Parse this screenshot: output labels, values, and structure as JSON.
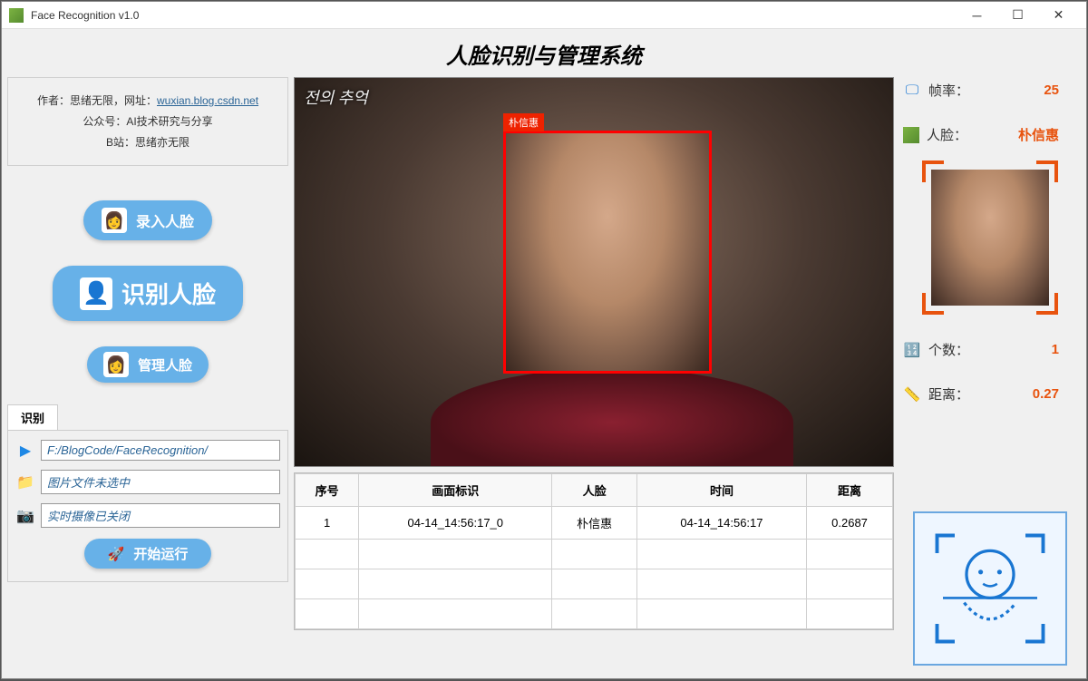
{
  "window": {
    "title": "Face Recognition v1.0"
  },
  "app_title": "人脸识别与管理系统",
  "info": {
    "author_label": "作者：",
    "author": "思绪无限",
    "url_label": "，网址：",
    "url": "wuxian.blog.csdn.net",
    "wechat_label": "公众号：",
    "wechat": "AI技术研究与分享",
    "bilibili_label": "B站：",
    "bilibili": "思绪亦无限"
  },
  "buttons": {
    "enroll": "录入人脸",
    "recognize": "识别人脸",
    "manage": "管理人脸",
    "run": "开始运行"
  },
  "tab": {
    "label": "识别",
    "video_path": "F:/BlogCode/FaceRecognition/",
    "image_status": "图片文件未选中",
    "camera_status": "实时摄像已关闭"
  },
  "video": {
    "overlay_text": "전의 추억",
    "detected_name": "朴信惠"
  },
  "stats": {
    "fps_label": "帧率：",
    "fps_value": "25",
    "face_label": "人脸：",
    "face_value": "朴信惠",
    "count_label": "个数：",
    "count_value": "1",
    "distance_label": "距离：",
    "distance_value": "0.27"
  },
  "table": {
    "headers": {
      "seq": "序号",
      "frame_id": "画面标识",
      "face": "人脸",
      "time": "时间",
      "distance": "距离"
    },
    "rows": [
      {
        "seq": "1",
        "frame_id": "04-14_14:56:17_0",
        "face": "朴信惠",
        "time": "04-14_14:56:17",
        "distance": "0.2687"
      }
    ]
  }
}
